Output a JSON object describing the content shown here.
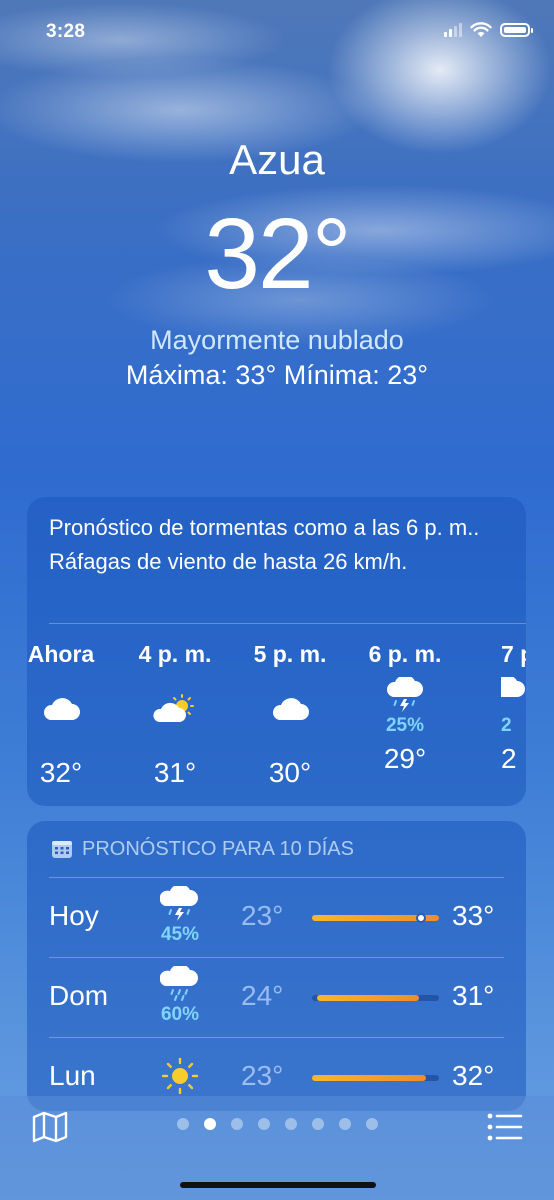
{
  "status_bar": {
    "time": "3:28",
    "icons": [
      "cellular-signal-icon",
      "wifi-icon",
      "battery-icon"
    ]
  },
  "location": {
    "city": "Azua",
    "temperature": "32°",
    "condition": "Mayormente nublado",
    "high_low": "Máxima: 33°  Mínima: 23°"
  },
  "hourly_card": {
    "summary": "Pronóstico de tormentas como a las 6 p. m.. Ráfagas de viento de hasta 26 km/h.",
    "hours": [
      {
        "label": "Ahora",
        "icon": "cloud-icon",
        "precip": "",
        "temp": "32°"
      },
      {
        "label": "4 p. m.",
        "icon": "partly-sunny-icon",
        "precip": "",
        "temp": "31°"
      },
      {
        "label": "5 p. m.",
        "icon": "cloud-icon",
        "precip": "",
        "temp": "30°"
      },
      {
        "label": "6 p. m.",
        "icon": "thunderstorm-icon",
        "precip": "25%",
        "temp": "29°"
      },
      {
        "label": "7 p",
        "icon": "thunderstorm-icon",
        "precip": "2",
        "temp": "2"
      }
    ]
  },
  "daily_card": {
    "header": "PRONÓSTICO PARA 10 DÍAS",
    "days": [
      {
        "day": "Hoy",
        "icon": "thunderstorm-icon",
        "precip": "45%",
        "low": "23°",
        "high": "33°",
        "range_start": 0.0,
        "range_end": 1.0,
        "current": 0.86
      },
      {
        "day": "Dom",
        "icon": "rain-icon",
        "precip": "60%",
        "low": "24°",
        "high": "31°",
        "range_start": 0.04,
        "range_end": 0.84,
        "current": null
      },
      {
        "day": "Lun",
        "icon": "sun-icon",
        "precip": "",
        "low": "23°",
        "high": "32°",
        "range_start": 0.0,
        "range_end": 0.9,
        "current": null
      }
    ]
  },
  "bottom_bar": {
    "page_count": 8,
    "active_page": 1
  },
  "colors": {
    "accent_precip": "#7fd4ff",
    "range_start": "#f5b82e",
    "range_end": "#f28b2d"
  }
}
